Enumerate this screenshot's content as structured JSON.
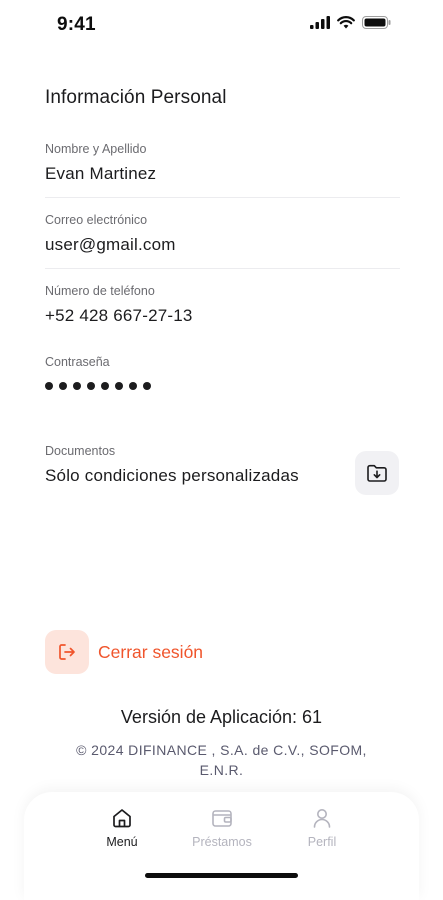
{
  "status_bar": {
    "time": "9:41"
  },
  "section_title": "Información Personal",
  "fields": {
    "name": {
      "label": "Nombre y Apellido",
      "value": "Evan Martinez"
    },
    "email": {
      "label": "Correo electrónico",
      "value": "user@gmail.com"
    },
    "phone": {
      "label": "Número de teléfono",
      "value": "+52 428 667-27-13"
    },
    "password": {
      "label": "Contraseña",
      "masked_length": 8
    },
    "documents": {
      "label": "Documentos",
      "value": "Sólo condiciones personalizadas"
    }
  },
  "logout": {
    "label": "Cerrar sesión"
  },
  "footer": {
    "version": "Versión de Aplicación: 61",
    "copyright": "© 2024 DIFINANCE , S.A. de C.V., SOFOM, E.N.R."
  },
  "tab_bar": {
    "tabs": [
      {
        "label": "Menú",
        "icon": "home-icon",
        "active": true
      },
      {
        "label": "Préstamos",
        "icon": "wallet-icon",
        "active": false
      },
      {
        "label": "Perfil",
        "icon": "user-icon",
        "active": false
      }
    ]
  },
  "colors": {
    "accent": "#f0552c",
    "accent_bg": "#fde4dc",
    "text": "#1c1c1e",
    "muted": "#6b6b70",
    "inactive_tab": "#b4b4be"
  }
}
